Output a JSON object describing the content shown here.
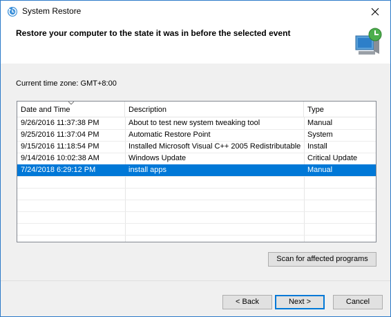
{
  "window": {
    "title": "System Restore"
  },
  "header": {
    "heading": "Restore your computer to the state it was in before the selected event"
  },
  "timezone": {
    "label": "Current time zone: GMT+8:00"
  },
  "table": {
    "columns": [
      "Date and Time",
      "Description",
      "Type"
    ],
    "rows": [
      {
        "date": "9/26/2016 11:37:38 PM",
        "description": "About to test new system tweaking tool",
        "type": "Manual"
      },
      {
        "date": "9/25/2016 11:37:04 PM",
        "description": "Automatic Restore Point",
        "type": "System"
      },
      {
        "date": "9/15/2016 11:18:54 PM",
        "description": "Installed Microsoft Visual C++ 2005 Redistributable",
        "type": "Install"
      },
      {
        "date": "9/14/2016 10:02:38 AM",
        "description": "Windows Update",
        "type": "Critical Update"
      },
      {
        "date": "7/24/2018 6:29:12 PM",
        "description": "install apps",
        "type": "Manual"
      }
    ],
    "selected_index": 4
  },
  "buttons": {
    "scan": "Scan for affected programs",
    "back": "< Back",
    "next": "Next >",
    "cancel": "Cancel"
  },
  "colors": {
    "selection": "#0078d7",
    "window_border": "#2b79c8"
  }
}
